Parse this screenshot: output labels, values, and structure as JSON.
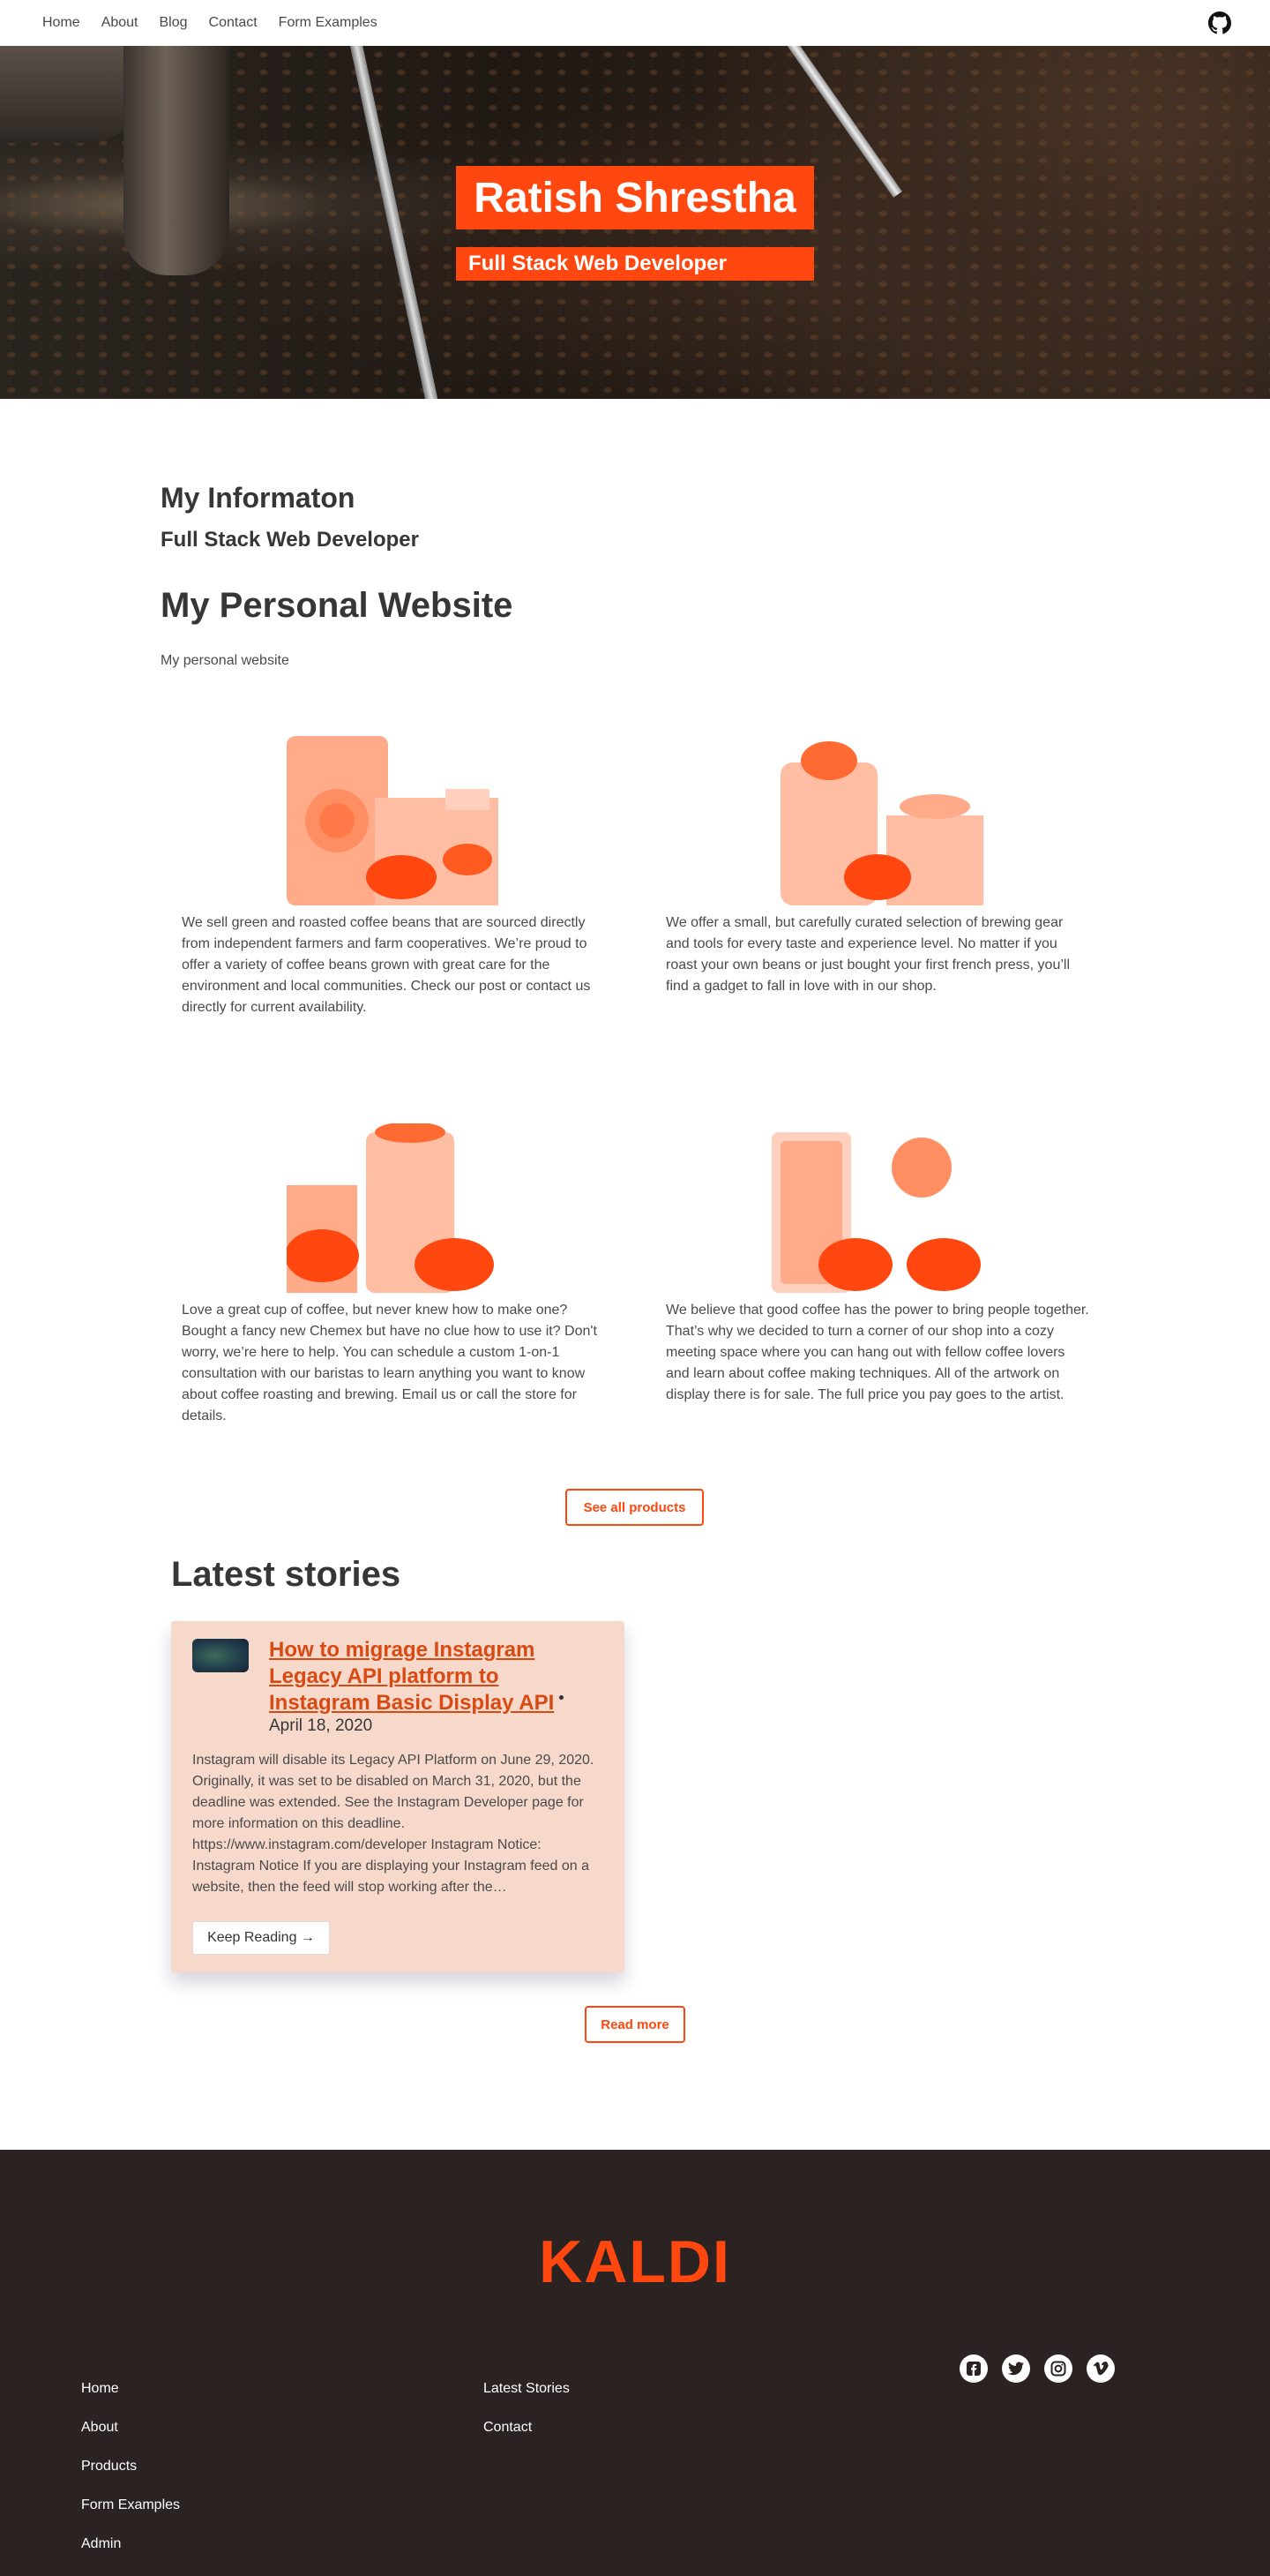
{
  "nav": {
    "links": [
      "Home",
      "About",
      "Blog",
      "Contact",
      "Form Examples"
    ],
    "github_icon": "github-icon"
  },
  "hero": {
    "title": "Ratish Shrestha",
    "subtitle": "Full Stack Web Developer",
    "background_icon": "coffee-roaster-photo"
  },
  "main": {
    "info_heading": "My Informaton",
    "role_heading": "Full Stack Web Developer",
    "site_heading": "My Personal Website",
    "site_text": "My personal website"
  },
  "features": [
    {
      "icon": "coffee-bag-icon",
      "text": "We sell green and roasted coffee beans that are sourced directly from independent farmers and farm cooperatives. We’re proud to offer a variety of coffee beans grown with great care for the environment and local communities. Check our post or contact us directly for current availability."
    },
    {
      "icon": "coffee-gear-icon",
      "text": "We offer a small, but carefully curated selection of brewing gear and tools for every taste and experience level. No matter if you roast your own beans or just bought your first french press, you’ll find a gadget to fall in love with in our shop."
    },
    {
      "icon": "coffee-class-icon",
      "text": "Love a great cup of coffee, but never knew how to make one? Bought a fancy new Chemex but have no clue how to use it? Don't worry, we’re here to help. You can schedule a custom 1-on-1 consultation with our baristas to learn anything you want to know about coffee roasting and brewing. Email us or call the store for details."
    },
    {
      "icon": "coffee-cups-icon",
      "text": "We believe that good coffee has the power to bring people together. That’s why we decided to turn a corner of our shop into a cozy meeting space where you can hang out with fellow coffee lovers and learn about coffee making techniques. All of the artwork on display there is for sale. The full price you pay goes to the artist."
    }
  ],
  "buttons": {
    "see_all_products": "See all products",
    "read_more": "Read more"
  },
  "latest": {
    "heading": "Latest stories",
    "post": {
      "title": "How to migrage Instagram Legacy API platform to Instagram Basic Display API",
      "date": "April 18, 2020",
      "excerpt": "Instagram will disable its Legacy API Platform on June 29, 2020. Originally, it was set to be disabled on March 31, 2020, but the deadline was extended. See the Instagram Developer page for more information on this deadline. https://www.instagram.com/developer Instagram Notice: Instagram Notice If you are displaying your Instagram feed on a website, then the feed will stop working after the…",
      "cta": "Keep Reading →"
    }
  },
  "footer": {
    "logo": "KALDI",
    "col1": [
      "Home",
      "About",
      "Products",
      "Form Examples",
      "Admin"
    ],
    "col2": [
      "Latest Stories",
      "Contact"
    ],
    "social": [
      "facebook-icon",
      "twitter-icon",
      "instagram-icon",
      "vimeo-icon"
    ]
  },
  "colors": {
    "accent": "#ff470f",
    "card_bg": "#f7d9cc",
    "footer_bg": "#2a2321",
    "text": "#4a4a4a"
  }
}
